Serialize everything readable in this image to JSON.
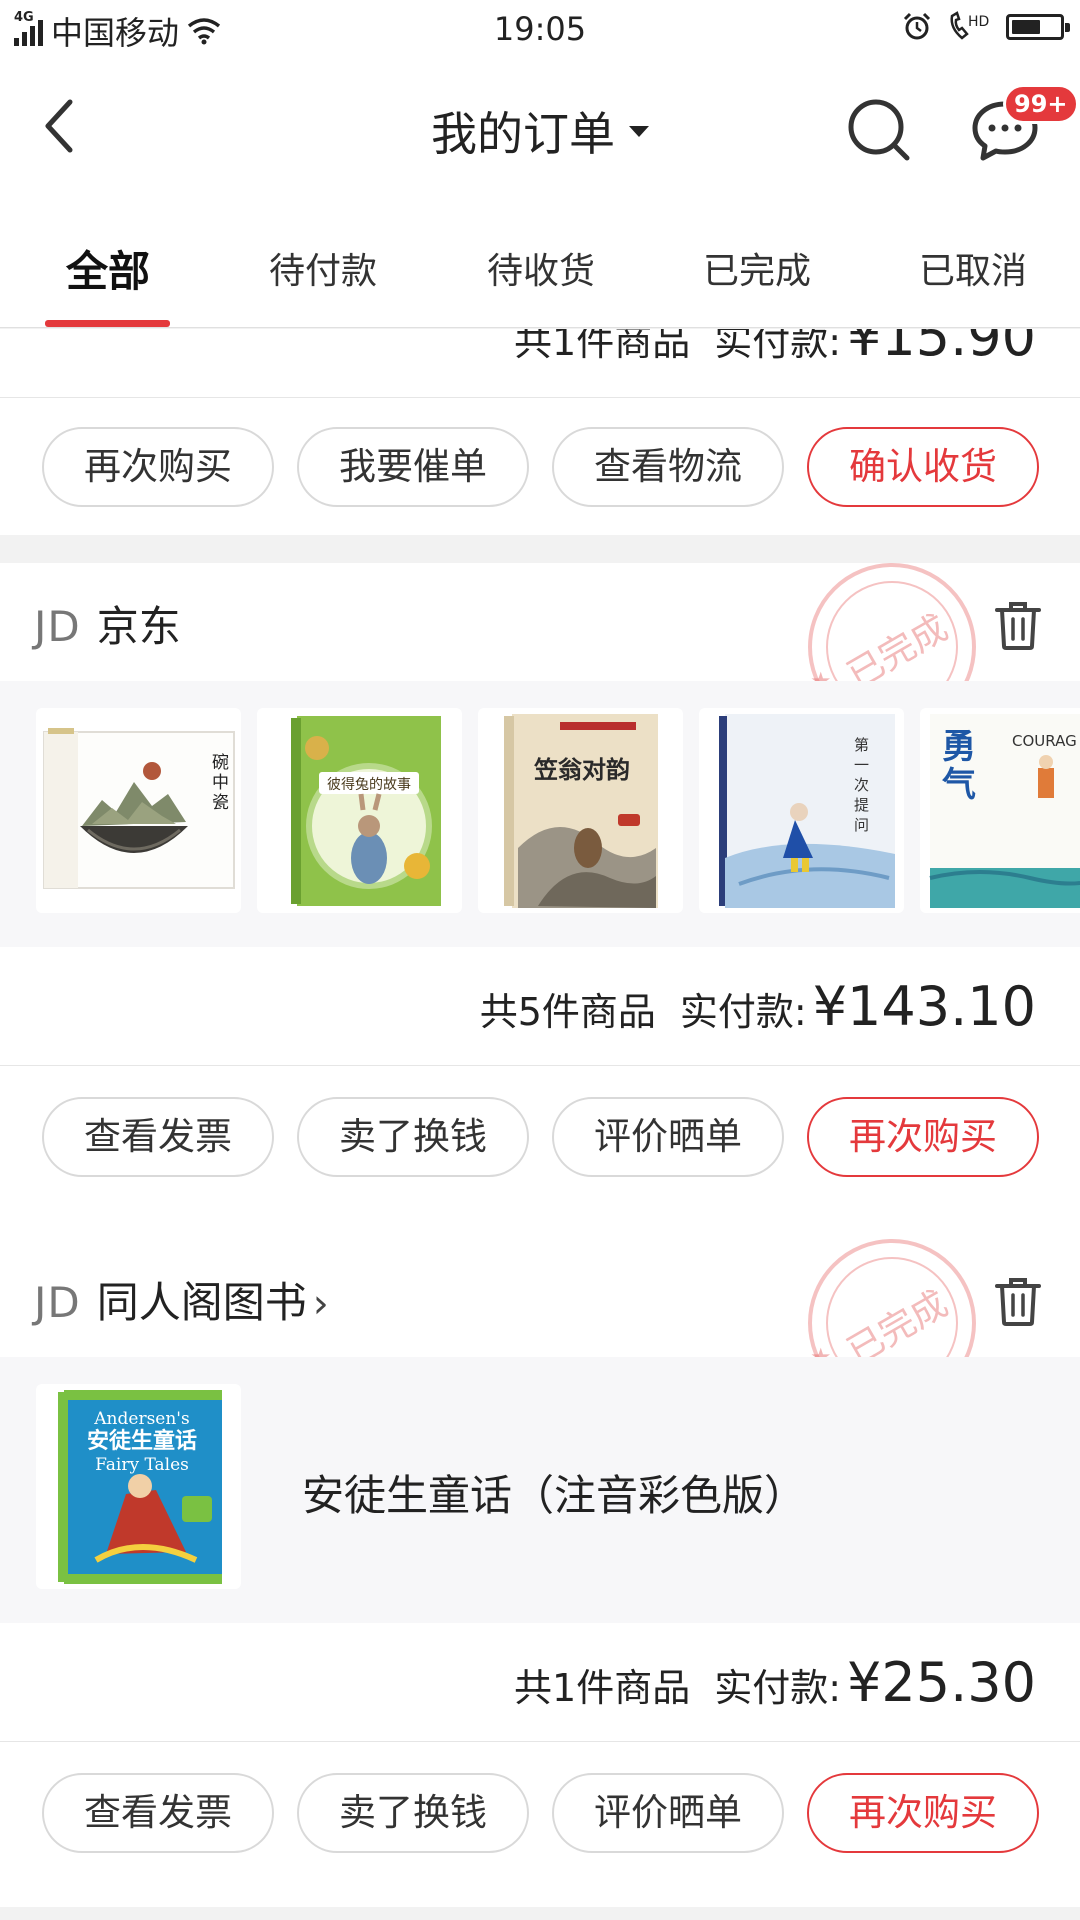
{
  "status_bar": {
    "network": "4G",
    "carrier": "中国移动",
    "time": "19:05",
    "hd": "HD",
    "battery_level": 0.6
  },
  "nav": {
    "title": "我的订单",
    "message_badge": "99+"
  },
  "tabs": [
    "全部",
    "待付款",
    "待收货",
    "已完成",
    "已取消"
  ],
  "active_tab": 0,
  "colors": {
    "accent": "#e4393c",
    "stamp": "#e87878"
  },
  "order_partial": {
    "count_label": "共1件商品",
    "paid_label": "实付款:",
    "amount": "¥15.90",
    "buttons": [
      "再次购买",
      "我要催单",
      "查看物流",
      "确认收货"
    ]
  },
  "order_jd": {
    "shop_prefix": "JD",
    "shop_name": "京东",
    "stamp": "已完成",
    "items_count": 5,
    "count_label": "共5件商品",
    "paid_label": "实付款:",
    "amount": "¥143.10",
    "book_cover_texts": [
      "碗中瓷",
      "彼得兔的故事",
      "笠翁对韵",
      "第一次提问",
      "勇气",
      "COURAG"
    ],
    "buttons": [
      "查看发票",
      "卖了换钱",
      "评价晒单",
      "再次购买"
    ]
  },
  "order_trj": {
    "shop_prefix": "JD",
    "shop_name": "同人阁图书",
    "stamp": "已完成",
    "goods_title": "安徒生童话（注音彩色版）",
    "cover_title_cn": "安徒生童话",
    "cover_title_en_1": "Andersen's",
    "cover_title_en_2": "Fairy Tales",
    "count_label": "共1件商品",
    "paid_label": "实付款:",
    "amount": "¥25.30",
    "buttons": [
      "查看发票",
      "卖了换钱",
      "评价晒单",
      "再次购买"
    ]
  }
}
